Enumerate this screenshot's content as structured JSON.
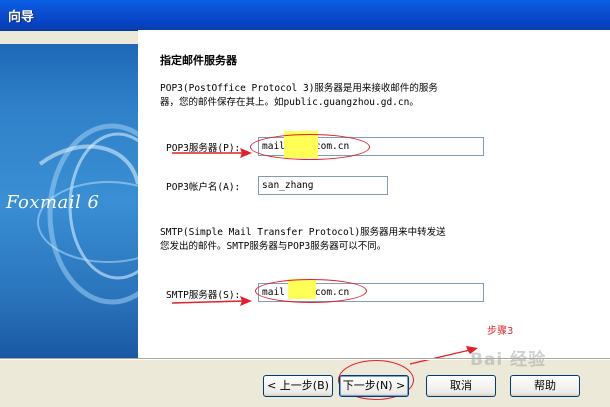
{
  "window": {
    "title": "向导"
  },
  "banner": {
    "brand": "Foxmail 6"
  },
  "page": {
    "heading": "指定邮件服务器",
    "pop3_desc_1": "POP3(PostOffice Protocol 3)服务器是用来接收邮件的服务",
    "pop3_desc_2": "器，您的邮件保存在其上。如public.guangzhou.gd.cn。",
    "smtp_desc_1": "SMTP(Simple Mail Transfer Protocol)服务器用来中转发送",
    "smtp_desc_2": "您发出的邮件。SMTP服务器与POP3服务器可以不同。"
  },
  "fields": {
    "pop3_label": "POP3服务器(P):",
    "pop3_value_a": "mail",
    "pop3_value_b": "com.cn",
    "account_label": "POP3帐户名(A):",
    "account_value": "san_zhang",
    "smtp_label": "SMTP服务器(S):",
    "smtp_value_a": "mail",
    "smtp_value_b": "com.cn"
  },
  "buttons": {
    "back": "< 上一步(B)",
    "next": "下一步(N) >",
    "cancel": "取消",
    "help": "帮助"
  },
  "annotation": {
    "step_label": "步骤3",
    "watermark": "Bai 经验"
  },
  "colors": {
    "annotation_red": "#e0202a",
    "highlight": "#ffff55",
    "titlebar": "#0a5fe4"
  }
}
